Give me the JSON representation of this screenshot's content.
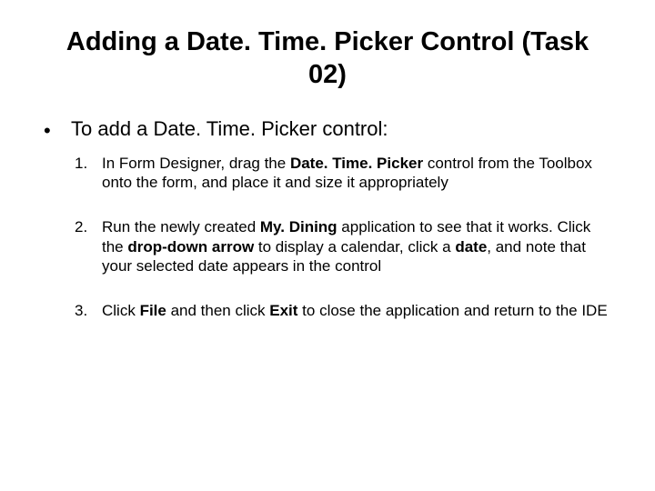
{
  "title": "Adding a Date. Time. Picker Control (Task 02)",
  "intro": "To add a Date. Time. Picker control:",
  "steps": [
    "In Form Designer, drag the <b>Date. Time. Picker</b> control from the Toolbox onto the form, and place it and size it appropriately",
    "Run the newly created <b>My. Dining</b> application to see that it works. Click the <b>drop-down arrow</b> to display a calendar, click a <b>date</b>, and note that your selected date appears in the control",
    "Click <b>File</b> and then click <b>Exit</b> to close the application and return to the IDE"
  ]
}
